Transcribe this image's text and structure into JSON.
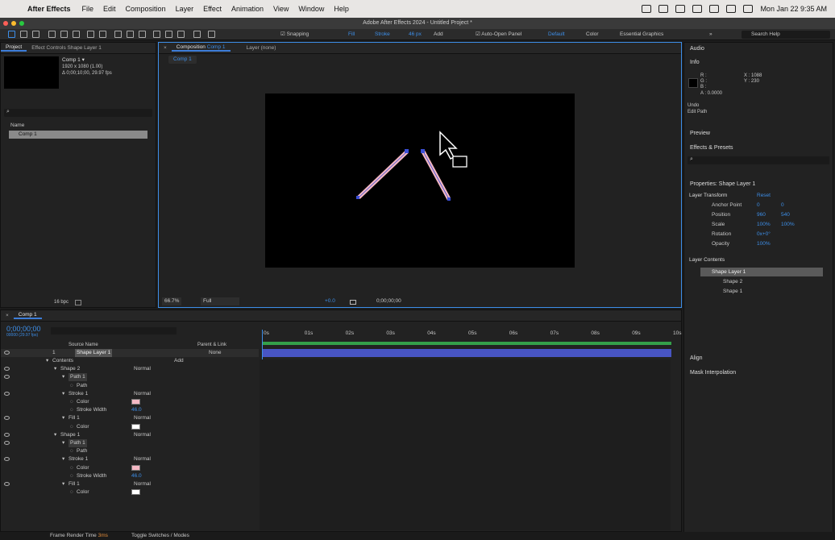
{
  "menubar": {
    "app": "After Effects",
    "items": [
      "File",
      "Edit",
      "Composition",
      "Layer",
      "Effect",
      "Animation",
      "View",
      "Window",
      "Help"
    ],
    "clock": "Mon Jan 22  9:35 AM"
  },
  "window": {
    "title": "Adobe After Effects 2024 - Untitled Project *"
  },
  "toolbar": {
    "snapping": "Snapping",
    "fill": "Fill",
    "stroke": "Stroke",
    "stroke_px": "46 px",
    "add": "Add",
    "auto_open": "Auto-Open Panel",
    "workspace_default": "Default",
    "workspace_color": "Color",
    "workspace_essential": "Essential Graphics",
    "search_help": "Search Help"
  },
  "project": {
    "tab": "Project",
    "tab2": "Effect Controls Shape Layer 1",
    "comp_name": "Comp 1 ▾",
    "comp_size": "1920 x 1080 (1.00)",
    "comp_dur": "Δ 0;00;10;00, 29.97 fps",
    "col_name": "Name",
    "item": "Comp 1",
    "bpc": "16 bpc"
  },
  "viewer": {
    "tab": "Composition",
    "tab_comp": "Comp 1",
    "layer_tab": "Layer (none)",
    "breadcrumb": "Comp 1",
    "zoom": "66.7%",
    "resolution": "Full",
    "exposure": "+0.0",
    "timecode": "0;00;00;00"
  },
  "timeline": {
    "tab": "Comp 1",
    "timecode": "0;00;00;00",
    "fps": "00000 (29.97 fps)",
    "col_source": "Source Name",
    "col_parent": "Parent & Link",
    "ruler": [
      "0s",
      "01s",
      "02s",
      "03s",
      "04s",
      "05s",
      "06s",
      "07s",
      "08s",
      "09s",
      "10s"
    ],
    "layer": {
      "num": "1",
      "name": "Shape Layer 1",
      "parent": "None"
    },
    "rows": [
      {
        "label": "Contents",
        "indent": 0,
        "extra": "Add"
      },
      {
        "label": "Shape 2",
        "indent": 1,
        "mode": "Normal"
      },
      {
        "label": "Path 1",
        "indent": 2,
        "hl": true
      },
      {
        "label": "Path",
        "indent": 3
      },
      {
        "label": "Stroke 1",
        "indent": 2,
        "mode": "Normal"
      },
      {
        "label": "Color",
        "indent": 3,
        "swatch": "#f4b8c4"
      },
      {
        "label": "Stroke Width",
        "indent": 3,
        "value": "46.0"
      },
      {
        "label": "Fill 1",
        "indent": 2,
        "mode": "Normal"
      },
      {
        "label": "Color",
        "indent": 3,
        "swatch": "#ffffff"
      },
      {
        "label": "Shape 1",
        "indent": 1,
        "mode": "Normal"
      },
      {
        "label": "Path 1",
        "indent": 2,
        "hl": true
      },
      {
        "label": "Path",
        "indent": 3
      },
      {
        "label": "Stroke 1",
        "indent": 2,
        "mode": "Normal"
      },
      {
        "label": "Color",
        "indent": 3,
        "swatch": "#f4b8c4"
      },
      {
        "label": "Stroke Width",
        "indent": 3,
        "value": "46.0"
      },
      {
        "label": "Fill 1",
        "indent": 2,
        "mode": "Normal"
      },
      {
        "label": "Color",
        "indent": 3,
        "swatch": "#ffffff"
      }
    ],
    "status_render": "Frame Render Time",
    "render_ms": "3ms",
    "toggle": "Toggle Switches / Modes"
  },
  "right": {
    "audio": "Audio",
    "info": "Info",
    "r": "R :",
    "g": "G :",
    "b": "B :",
    "a": "A : 0.0000",
    "x": "X : 1088",
    "y": "Y : 230",
    "undo": "Undo",
    "undo_action": "Edit Path",
    "preview": "Preview",
    "effects": "Effects & Presets",
    "props_title": "Properties: Shape Layer 1",
    "layer_transform": "Layer Transform",
    "reset": "Reset",
    "props": [
      {
        "name": "Anchor Point",
        "v1": "0",
        "v2": "0"
      },
      {
        "name": "Position",
        "v1": "960",
        "v2": "540"
      },
      {
        "name": "Scale",
        "v1": "100%",
        "v2": "100%"
      },
      {
        "name": "Rotation",
        "v1": "0x+0°",
        "v2": ""
      },
      {
        "name": "Opacity",
        "v1": "100%",
        "v2": ""
      }
    ],
    "layer_contents": "Layer Contents",
    "contents": [
      "Shape Layer 1",
      "Shape 2",
      "Shape 1"
    ],
    "align": "Align",
    "mask": "Mask Interpolation"
  },
  "colors": {
    "accent": "#3d8ee8",
    "stroke_pink": "#f4b8c4",
    "layer_bar": "#4855c4",
    "workarea": "#34a04a"
  }
}
